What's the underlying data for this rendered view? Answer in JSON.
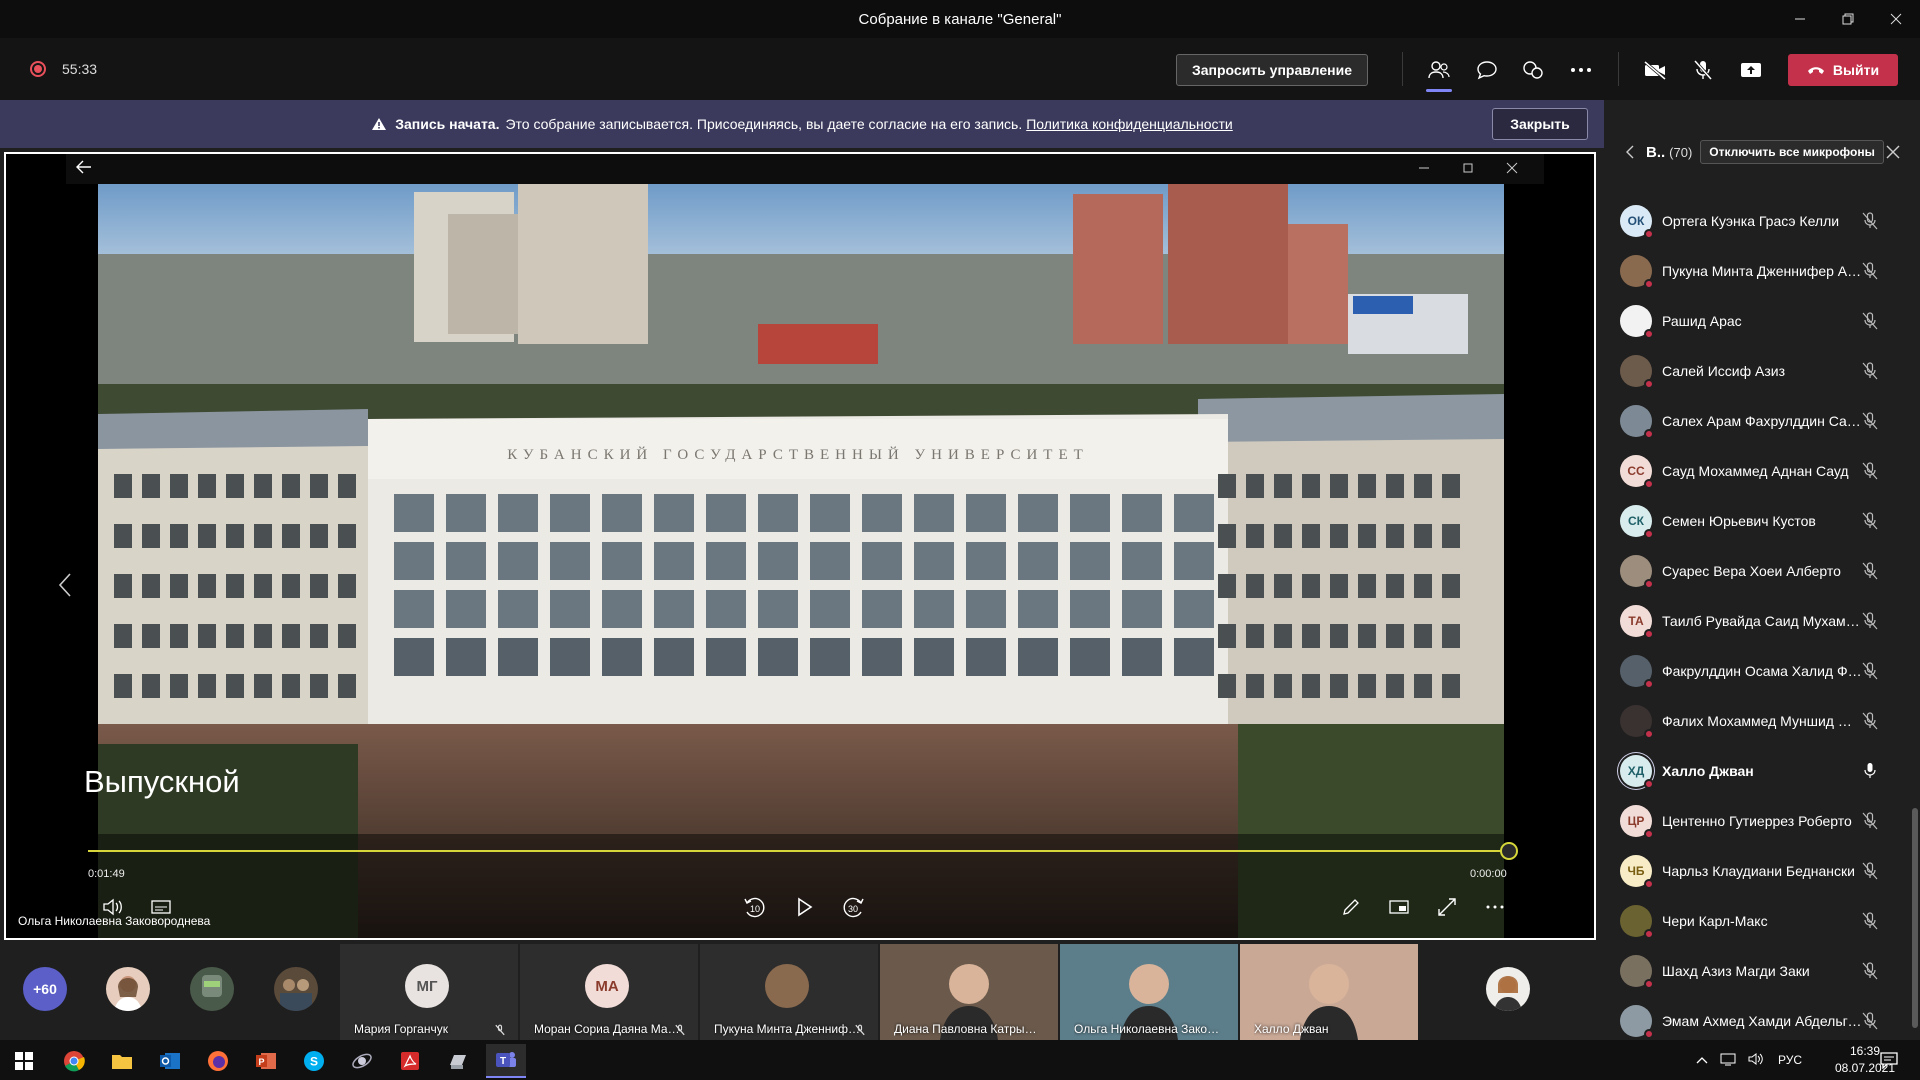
{
  "window": {
    "title": "Собрание в канале \"General\""
  },
  "toolbar": {
    "timer": "55:33",
    "request_control": "Запросить управление",
    "leave": "Выйти",
    "accent": "#7f85f5",
    "leave_color": "#c4314b"
  },
  "banner": {
    "bold": "Запись начата.",
    "text": "Это собрание записывается. Присоединяясь, вы даете согласие на его запись.",
    "link": "Политика конфиденциальности",
    "close": "Закрыть"
  },
  "player": {
    "title": "Выпускной",
    "elapsed": "0:01:49",
    "remaining": "0:00:00",
    "rewind_label": "10",
    "forward_label": "30",
    "progress_percent": 100,
    "building_sign": "КУБАНСКИЙ ГОСУДАРСТВЕННЫЙ УНИВЕРСИТЕТ",
    "presenter": "Ольга Николаевна Заковороднева"
  },
  "panel": {
    "title": "В..",
    "count": "(70)",
    "mute_all": "Отключить все микрофоны",
    "participants": [
      {
        "name": "Ортега Куэнка Грасэ Келли",
        "initials": "ОК",
        "color": "#d9e9f5",
        "fg": "#245077",
        "photo": false,
        "muted": true,
        "speaking": false
      },
      {
        "name": "Пукуна Минта Дженнифер Анна",
        "initials": "",
        "color": "#8a6a4f",
        "fg": "#fff",
        "photo": true,
        "muted": true,
        "speaking": false
      },
      {
        "name": "Рашид Арас",
        "initials": "",
        "color": "#f2f2f2",
        "fg": "#222",
        "photo": true,
        "muted": true,
        "speaking": false
      },
      {
        "name": "Салей Иссиф Азиз",
        "initials": "",
        "color": "#6c5a4b",
        "fg": "#fff",
        "photo": true,
        "muted": true,
        "speaking": false
      },
      {
        "name": "Салех Арам Фахрулддин Салех",
        "initials": "",
        "color": "#7d8a96",
        "fg": "#fff",
        "photo": true,
        "muted": true,
        "speaking": false
      },
      {
        "name": "Сауд Мохаммед Аднан Сауд",
        "initials": "СС",
        "color": "#f2dcd8",
        "fg": "#8a3b2c",
        "photo": false,
        "muted": true,
        "speaking": false
      },
      {
        "name": "Семен Юрьевич Кустов",
        "initials": "СК",
        "color": "#d8ecee",
        "fg": "#1f6068",
        "photo": false,
        "muted": true,
        "speaking": false
      },
      {
        "name": "Суарес Вера Хоеи Алберто",
        "initials": "",
        "color": "#9c8d7d",
        "fg": "#fff",
        "photo": true,
        "muted": true,
        "speaking": false
      },
      {
        "name": "Таилб Рувайда Саид Мухаммед",
        "initials": "ТА",
        "color": "#f2dcd8",
        "fg": "#8a3b2c",
        "photo": false,
        "muted": true,
        "speaking": false
      },
      {
        "name": "Факрулддин Осама Халид Факрулддин",
        "initials": "",
        "color": "#55606b",
        "fg": "#fff",
        "photo": true,
        "muted": true,
        "speaking": false
      },
      {
        "name": "Фалих Мохаммед Муншид Фалих",
        "initials": "",
        "color": "#3a3230",
        "fg": "#fff",
        "photo": true,
        "muted": true,
        "speaking": false
      },
      {
        "name": "Халло Джван",
        "initials": "ХД",
        "color": "#d8ecee",
        "fg": "#1f6068",
        "photo": false,
        "muted": false,
        "speaking": true
      },
      {
        "name": "Центенно Гутиеррез Роберто",
        "initials": "ЦР",
        "color": "#f2dcd8",
        "fg": "#8a3b2c",
        "photo": false,
        "muted": true,
        "speaking": false
      },
      {
        "name": "Чарльз Клаудиани Беднански",
        "initials": "ЧБ",
        "color": "#f7ecc6",
        "fg": "#7a5f12",
        "photo": false,
        "muted": true,
        "speaking": false
      },
      {
        "name": "Чери Карл-Макс",
        "initials": "",
        "color": "#6a6230",
        "fg": "#fff",
        "photo": true,
        "muted": true,
        "speaking": false
      },
      {
        "name": "Шахд Азиз Магди Заки",
        "initials": "",
        "color": "#7a7060",
        "fg": "#fff",
        "photo": true,
        "muted": true,
        "speaking": false
      },
      {
        "name": "Эмам Ахмед Хамди Абдельгавад",
        "initials": "",
        "color": "#8d9aa3",
        "fg": "#fff",
        "photo": true,
        "muted": true,
        "speaking": false
      }
    ]
  },
  "strip": {
    "more": "+60",
    "tiles": [
      {
        "name": "Мария Горганчук",
        "initials": "МГ",
        "color": "#e8e3e0",
        "fg": "#555",
        "video": false
      },
      {
        "name": "Моран Сориа Даяна Мария",
        "initials": "МА",
        "color": "#f2dcd8",
        "fg": "#8a3b2c",
        "video": false
      },
      {
        "name": "Пукуна Минта Дженнифер Анна",
        "initials": "",
        "color": "#8a6a4f",
        "fg": "#fff",
        "video": false
      },
      {
        "name": "Диана Павловна Катрычева",
        "initials": "",
        "color": "#6b5a4c",
        "fg": "#fff",
        "video": true
      },
      {
        "name": "Ольга Николаевна Заковороднева",
        "initials": "",
        "color": "#5c7d8a",
        "fg": "#fff",
        "video": true
      },
      {
        "name": "Халло Джван",
        "initials": "",
        "color": "#c9a896",
        "fg": "#fff",
        "video": true
      }
    ]
  },
  "taskbar": {
    "lang": "РУС",
    "time": "16:39",
    "date": "08.07.2021"
  }
}
